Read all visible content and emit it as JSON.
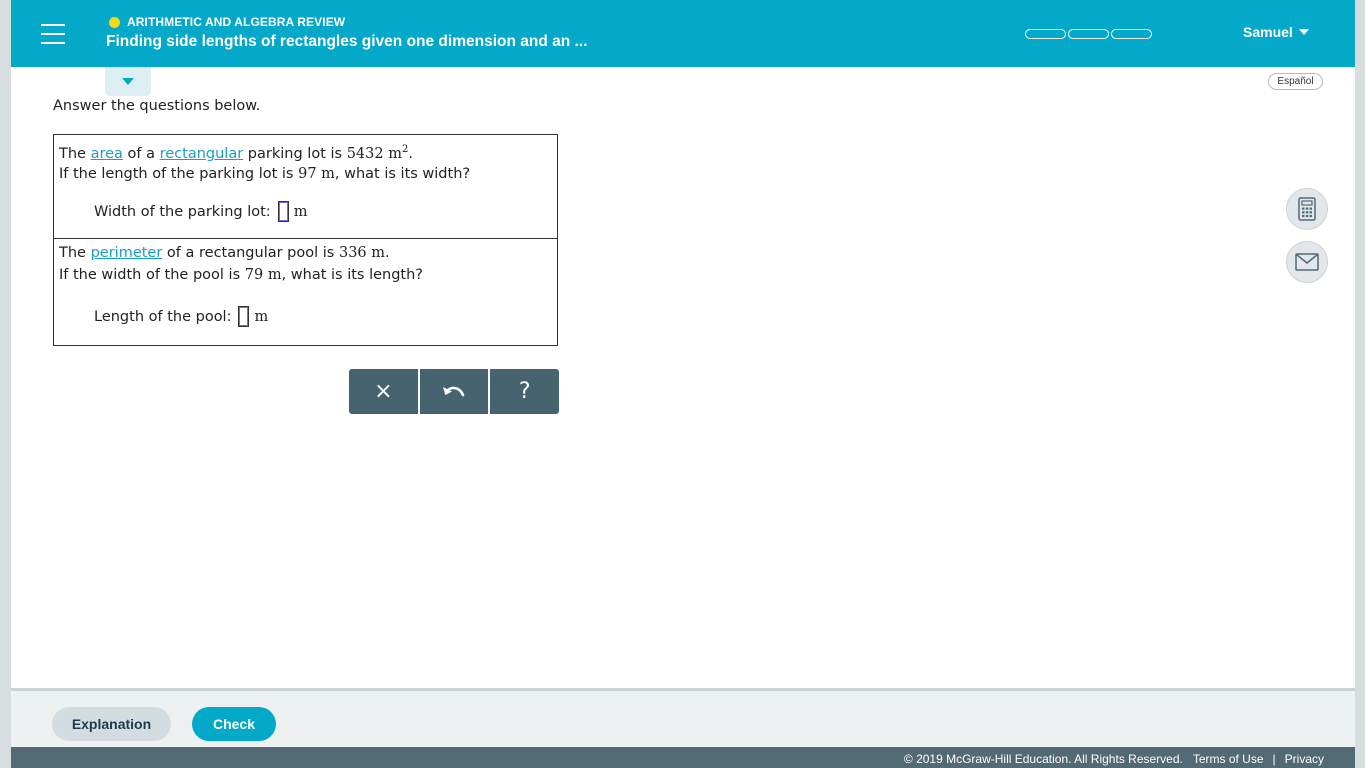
{
  "header": {
    "topic": "ARITHMETIC AND ALGEBRA REVIEW",
    "title": "Finding side lengths of rectangles given one dimension and an ...",
    "user_name": "Samuel",
    "progress_segments": 3,
    "colors": {
      "header_bg": "#04a8c8",
      "topic_dot": "#f4d81a"
    }
  },
  "language_button": "Español",
  "instructions": "Answer the questions below.",
  "question1": {
    "t1": "The ",
    "link_area": "area",
    "t2": " of a ",
    "link_rect": "rectangular",
    "t3": " parking lot is ",
    "area_value": "5432",
    "area_unit": "m",
    "area_exp": "2",
    "t4": ".",
    "l2a": "If the length of the parking lot is ",
    "length_value": "97",
    "length_unit": "m",
    "l2b": ", what is its width?",
    "answer_label": "Width of the parking lot:",
    "answer_value": "",
    "answer_unit": "m"
  },
  "question2": {
    "t1": "The ",
    "link_perimeter": "perimeter",
    "t2": " of a rectangular pool is ",
    "perimeter_value": "336",
    "perimeter_unit": "m",
    "t3": ".",
    "l2a": "If the width of the pool is ",
    "width_value": "79",
    "width_unit": "m",
    "l2b": ", what is its length?",
    "answer_label": "Length of the pool:",
    "answer_value": "",
    "answer_unit": "m"
  },
  "tools": {
    "clear": "×",
    "help": "?"
  },
  "actions": {
    "explanation": "Explanation",
    "check": "Check"
  },
  "footer": {
    "copyright": "© 2019 McGraw-Hill Education. All Rights Reserved.",
    "terms": "Terms of Use",
    "separator": "|",
    "privacy": "Privacy"
  }
}
